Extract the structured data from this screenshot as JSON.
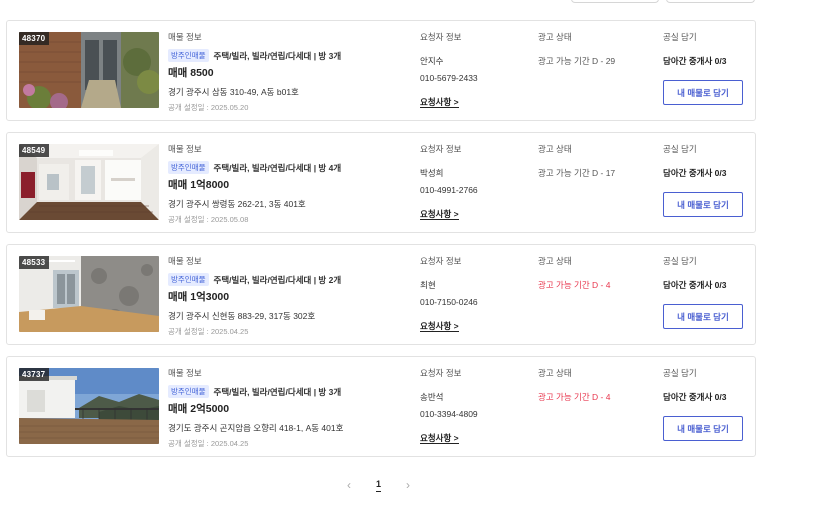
{
  "labels": {
    "listing_info": "매물 정보",
    "requester_info": "요청자 정보",
    "ad_status": "광고 상태",
    "shared_claim": "공실 담기",
    "request_details": "요청사항 >",
    "claim_button": "내 매물로 담기",
    "exclusive_tag": "방주인매물"
  },
  "listings": [
    {
      "id": "48370",
      "type": "주택/빌라, 빌라/연립/다세대 | 방 3개",
      "price": "매매 8500",
      "address": "경기 광주시 삼동 310-49, A동 b01호",
      "published": "공개 설정일 : 2025.05.20",
      "requester_name": "안지수",
      "requester_phone": "010-5679-2433",
      "ad_status": "광고 가능 기간 D - 29",
      "ad_status_alert": false,
      "agent_count": "담아간 중개사 0/3"
    },
    {
      "id": "48549",
      "type": "주택/빌라, 빌라/연립/다세대 | 방 4개",
      "price": "매매 1억8000",
      "address": "경기 광주시 쌍령동 262-21, 3동 401호",
      "published": "공개 설정일 : 2025.05.08",
      "requester_name": "박성희",
      "requester_phone": "010-4991-2766",
      "ad_status": "광고 가능 기간 D - 17",
      "ad_status_alert": false,
      "agent_count": "담아간 중개사 0/3"
    },
    {
      "id": "48533",
      "type": "주택/빌라, 빌라/연립/다세대 | 방 2개",
      "price": "매매 1억3000",
      "address": "경기 광주시 신현동 883-29, 317동 302호",
      "published": "공개 설정일 : 2025.04.25",
      "requester_name": "최현",
      "requester_phone": "010-7150-0246",
      "ad_status": "광고 가능 기간 D - 4",
      "ad_status_alert": true,
      "agent_count": "담아간 중개사 0/3"
    },
    {
      "id": "43737",
      "type": "주택/빌라, 빌라/연립/다세대 | 방 3개",
      "price": "매매 2억5000",
      "address": "경기도 광주시 곤지암읍 오향리 418-1, A동 401호",
      "published": "공개 설정일 : 2025.04.25",
      "requester_name": "송반석",
      "requester_phone": "010-3394-4809",
      "ad_status": "광고 가능 기간 D - 4",
      "ad_status_alert": true,
      "agent_count": "담아간 중개사 0/3"
    }
  ],
  "pagination": {
    "prev": "‹",
    "current": "1",
    "next": "›"
  },
  "colors": {
    "accent": "#4a5fd1",
    "alert": "#e8384f",
    "tag_bg": "#e5ebff"
  }
}
